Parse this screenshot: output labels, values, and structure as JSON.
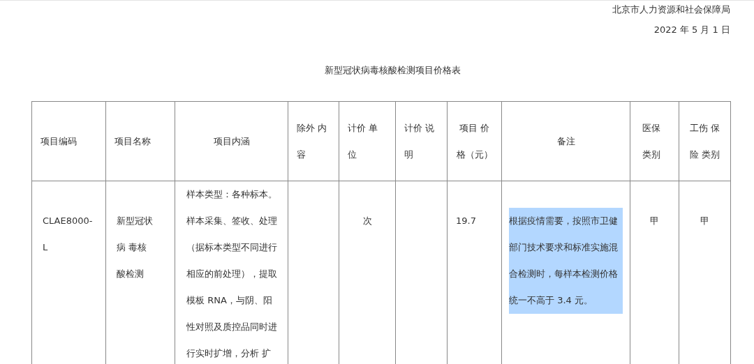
{
  "header": {
    "issuer": "北京市人力资源和社会保障局",
    "date": "2022 年 5 月 1 日"
  },
  "title": "新型冠状病毒核酸检测项目价格表",
  "table": {
    "columns": [
      "项目编码",
      "项目名称",
      "项目内涵",
      "除外 内容",
      "计价 单位",
      "计价 说明",
      "项目 价格（元）",
      "备注",
      "医保类别",
      "工伤 保险 类别"
    ],
    "rows": [
      {
        "code": "CLAE8000-L",
        "name": "新型冠状病 毒核酸检测",
        "content": "样本类型：各种标本。样本采集、签收、处理（据标本类型不同进行相应的前处理），提取模板 RNA，与阴、阳性对照及质控品同时进行实时扩增，分析 扩",
        "unit": "次",
        "price": "19.7",
        "remark": "根据疫情需要，按照市卫健部门技术要求和标准实施混合检测时，每样本检测价格统一不高于 3.4 元。",
        "remark_selected": true,
        "medical": "甲",
        "injury": "甲"
      }
    ]
  }
}
